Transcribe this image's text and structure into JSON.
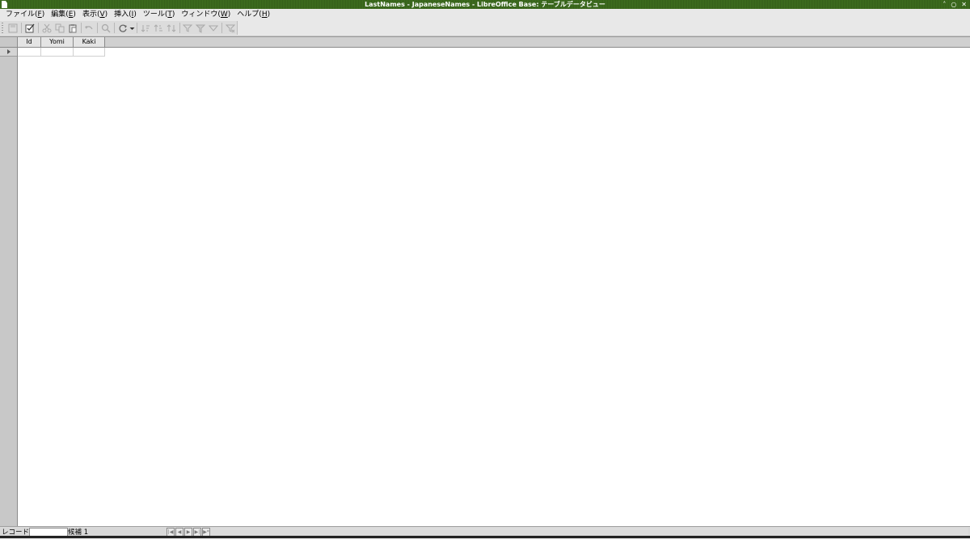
{
  "window": {
    "title": "LastNames - JapaneseNames - LibreOffice Base: テーブルデータビュー",
    "controls": {
      "minimize": "˄",
      "maximize": "○",
      "close": "✕"
    }
  },
  "menu": [
    {
      "label": "ファイル(",
      "key": "F",
      "end": ")"
    },
    {
      "label": "編集(",
      "key": "E",
      "end": ")"
    },
    {
      "label": "表示(",
      "key": "V",
      "end": ")"
    },
    {
      "label": "挿入(",
      "key": "I",
      "end": ")"
    },
    {
      "label": "ツール(",
      "key": "T",
      "end": ")"
    },
    {
      "label": "ウィンドウ(",
      "key": "W",
      "end": ")"
    },
    {
      "label": "ヘルプ(",
      "key": "H",
      "end": ")"
    }
  ],
  "table": {
    "columns": [
      "Id",
      "Yomi",
      "Kaki"
    ]
  },
  "status": {
    "record_label": "レコード",
    "record_value": "",
    "candidate_label": "候補 1"
  },
  "colors": {
    "titlebar": "#3c6a1e",
    "background": "#e6e6e6"
  }
}
